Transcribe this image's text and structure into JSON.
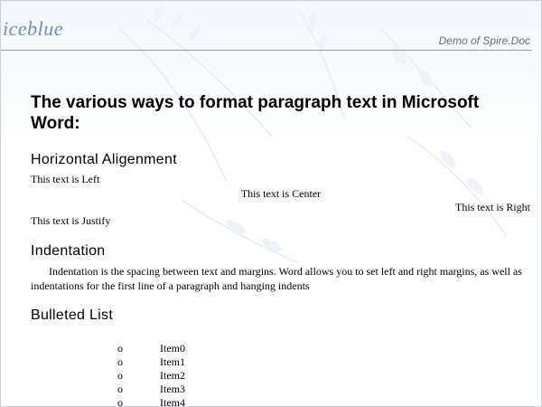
{
  "header": {
    "brand": "iceblue",
    "demo_label": "Demo of Spire.Doc"
  },
  "document": {
    "title": "The various ways to format paragraph text in Microsoft Word:",
    "sections": {
      "horizontal": {
        "heading": "Horizontal Aligenment",
        "left": "This text is Left",
        "center": "This text is Center",
        "right": "This text is Right",
        "justify": "This text is Justify"
      },
      "indentation": {
        "heading": "Indentation",
        "body": "Indentation is the spacing between text and margins. Word allows you to set left and right margins, as well as indentations for the first line of a paragraph and hanging indents"
      },
      "bulleted": {
        "heading": "Bulleted List",
        "bullet_symbol": "o",
        "items": [
          "Item0",
          "Item1",
          "Item2",
          "Item3",
          "Item4"
        ]
      }
    }
  }
}
